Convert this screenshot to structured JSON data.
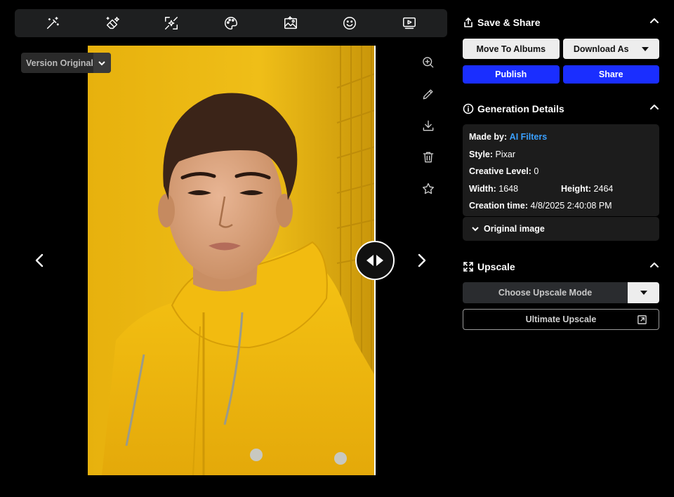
{
  "toolbar": {
    "tools": [
      {
        "icon": "magic-wand-icon"
      },
      {
        "icon": "eraser-sparkle-icon"
      },
      {
        "icon": "expand-sparkle-icon"
      },
      {
        "icon": "palette-icon"
      },
      {
        "icon": "image-landscape-icon"
      },
      {
        "icon": "smiley-icon"
      },
      {
        "icon": "video-play-icon"
      }
    ]
  },
  "viewer": {
    "version_label": "Version Original",
    "side_tools": [
      {
        "icon": "zoom-in-icon"
      },
      {
        "icon": "pencil-icon"
      },
      {
        "icon": "download-icon"
      },
      {
        "icon": "trash-icon"
      },
      {
        "icon": "star-icon"
      }
    ]
  },
  "panel": {
    "save_share": {
      "title": "Save & Share",
      "move_to_albums": "Move To Albums",
      "download_as": "Download As",
      "publish": "Publish",
      "share": "Share"
    },
    "generation": {
      "title": "Generation Details",
      "made_by_key": "Made by:",
      "made_by_val": "AI Filters",
      "style_key": "Style:",
      "style_val": "Pixar",
      "creative_key": "Creative Level:",
      "creative_val": "0",
      "width_key": "Width:",
      "width_val": "1648",
      "height_key": "Height:",
      "height_val": "2464",
      "time_key": "Creation time:",
      "time_val": "4/8/2025 2:40:08 PM",
      "original_image": "Original image"
    },
    "upscale": {
      "title": "Upscale",
      "mode": "Choose Upscale Mode",
      "ultimate": "Ultimate Upscale"
    }
  },
  "colors": {
    "accent_blue": "#1a2eff",
    "link_blue": "#3aa0ff",
    "panel_bg": "#1c1c1c",
    "photo_yellow": "#e9b30e"
  }
}
